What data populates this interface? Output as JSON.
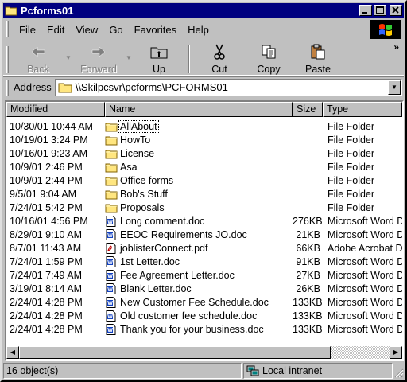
{
  "window": {
    "title": "Pcforms01"
  },
  "menu": {
    "items": [
      {
        "label": "File"
      },
      {
        "label": "Edit"
      },
      {
        "label": "View"
      },
      {
        "label": "Go"
      },
      {
        "label": "Favorites"
      },
      {
        "label": "Help"
      }
    ]
  },
  "toolbar": {
    "back_label": "Back",
    "forward_label": "Forward",
    "up_label": "Up",
    "cut_label": "Cut",
    "copy_label": "Copy",
    "paste_label": "Paste",
    "more_label": "»"
  },
  "address": {
    "label": "Address",
    "value": "\\\\Skilpcsvr\\pcforms\\PCFORMS01"
  },
  "columns": {
    "modified": "Modified",
    "name": "Name",
    "size": "Size",
    "type": "Type"
  },
  "files": [
    {
      "modified": "10/30/01 10:44 AM",
      "name": "AllAbout",
      "size": "",
      "type": "File Folder",
      "icon": "folder-icon"
    },
    {
      "modified": "10/19/01 3:24 PM",
      "name": "HowTo",
      "size": "",
      "type": "File Folder",
      "icon": "folder-icon"
    },
    {
      "modified": "10/16/01 9:23 AM",
      "name": "License",
      "size": "",
      "type": "File Folder",
      "icon": "folder-icon"
    },
    {
      "modified": "10/9/01 2:46 PM",
      "name": "Asa",
      "size": "",
      "type": "File Folder",
      "icon": "folder-icon"
    },
    {
      "modified": "10/9/01 2:44 PM",
      "name": "Office forms",
      "size": "",
      "type": "File Folder",
      "icon": "folder-icon"
    },
    {
      "modified": "9/5/01 9:04 AM",
      "name": "Bob's Stuff",
      "size": "",
      "type": "File Folder",
      "icon": "folder-icon"
    },
    {
      "modified": "7/24/01 5:42 PM",
      "name": "Proposals",
      "size": "",
      "type": "File Folder",
      "icon": "folder-icon"
    },
    {
      "modified": "10/16/01 4:56 PM",
      "name": "Long comment.doc",
      "size": "276KB",
      "type": "Microsoft Word D",
      "icon": "word-doc-icon"
    },
    {
      "modified": "8/29/01 9:10 AM",
      "name": "EEOC Requirements JO.doc",
      "size": "21KB",
      "type": "Microsoft Word D",
      "icon": "word-doc-icon"
    },
    {
      "modified": "8/7/01 11:43 AM",
      "name": "joblisterConnect.pdf",
      "size": "66KB",
      "type": "Adobe Acrobat D",
      "icon": "pdf-icon"
    },
    {
      "modified": "7/24/01 1:59 PM",
      "name": "1st Letter.doc",
      "size": "91KB",
      "type": "Microsoft Word D",
      "icon": "word-doc-icon"
    },
    {
      "modified": "7/24/01 7:49 AM",
      "name": "Fee Agreement Letter.doc",
      "size": "27KB",
      "type": "Microsoft Word D",
      "icon": "word-doc-icon"
    },
    {
      "modified": "3/19/01 8:14 AM",
      "name": "Blank Letter.doc",
      "size": "26KB",
      "type": "Microsoft Word D",
      "icon": "word-doc-icon"
    },
    {
      "modified": "2/24/01 4:28 PM",
      "name": "New Customer Fee Schedule.doc",
      "size": "133KB",
      "type": "Microsoft Word D",
      "icon": "word-doc-icon"
    },
    {
      "modified": "2/24/01 4:28 PM",
      "name": "Old customer fee schedule.doc",
      "size": "133KB",
      "type": "Microsoft Word D",
      "icon": "word-doc-icon"
    },
    {
      "modified": "2/24/01 4:28 PM",
      "name": "Thank you for your business.doc",
      "size": "133KB",
      "type": "Microsoft Word D",
      "icon": "word-doc-icon"
    }
  ],
  "status": {
    "count": "16 object(s)",
    "zone": "Local intranet"
  },
  "colors": {
    "titlebar": "#000080",
    "face": "#c0c0c0",
    "folder": "#ffe680"
  }
}
